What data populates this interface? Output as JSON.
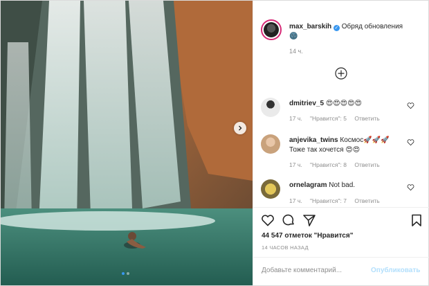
{
  "post": {
    "author": "max_barskih",
    "caption_text": "Обряд обновления",
    "caption_emoji": "🌚",
    "time": "14 ч.",
    "likes": "44 547 отметок \"Нравится\"",
    "time_ago": "14 ЧАСОВ НАЗАД",
    "add_comment_placeholder": "Добавьте комментарий...",
    "publish_label": "Опубликовать",
    "carousel": {
      "count": 2,
      "active": 1
    }
  },
  "comments": [
    {
      "user": "dmitriev_5",
      "text": "😍😍😍😍😍",
      "time": "17 ч.",
      "likes": "\"Нравится\": 5",
      "reply": "Ответить"
    },
    {
      "user": "anjevika_twins",
      "text": "Космос🚀🚀🚀",
      "text2": "Тоже так хочется 😍😍",
      "time": "17 ч.",
      "likes": "\"Нравится\": 8",
      "reply": "Ответить"
    },
    {
      "user": "ornelagram",
      "text": "Not bad.",
      "time": "17 ч.",
      "likes": "\"Нравится\": 7",
      "reply": "Ответить"
    }
  ],
  "colors": {
    "accent": "#3897f0",
    "muted": "#8e8e8e",
    "text": "#262626"
  },
  "icons": [
    "verified-icon",
    "load-more-icon",
    "heart-icon",
    "comment-icon",
    "share-icon",
    "bookmark-icon",
    "chevron-right-icon"
  ]
}
